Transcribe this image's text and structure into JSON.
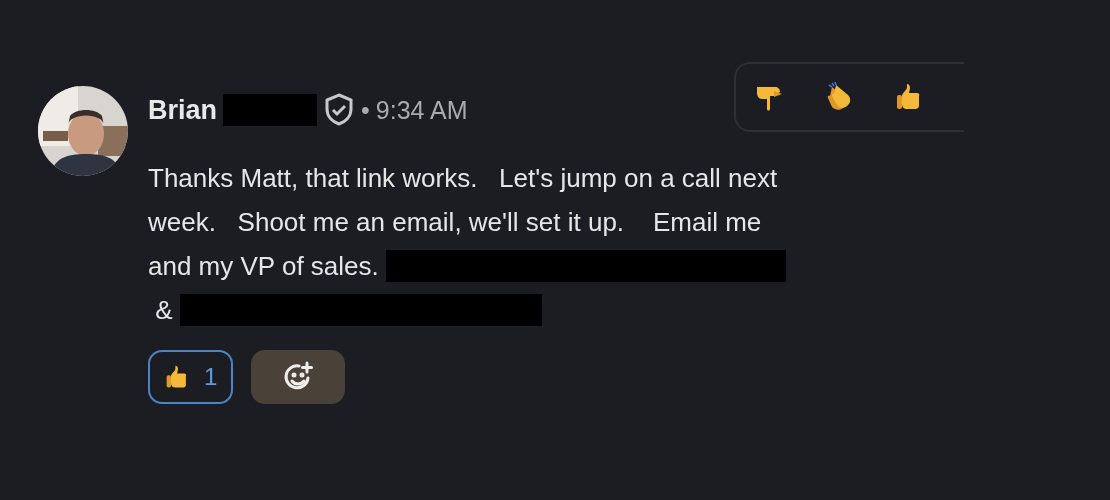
{
  "message": {
    "avatar": {
      "kind": "picture"
    },
    "author": "Brian",
    "author_redacted": true,
    "verified": true,
    "separator": "•",
    "time": "9:34 AM",
    "lines": [
      [
        {
          "kind": "text",
          "text": "Thanks Matt, that link works.   Let's jump on a call next"
        }
      ],
      [
        {
          "kind": "text",
          "text": "week.   Shoot me an email, we'll set it up.    Email me"
        }
      ],
      [
        {
          "kind": "text",
          "text": "and my VP of sales. "
        },
        {
          "kind": "redacted"
        }
      ],
      [
        {
          "kind": "text",
          "text": " & "
        },
        {
          "kind": "redacted"
        }
      ]
    ],
    "reactions": [
      {
        "kind": "thumbs-up",
        "count": "1",
        "selected": true
      }
    ],
    "quick_reactions": [
      {
        "kind": "pointing-down"
      },
      {
        "kind": "clap"
      },
      {
        "kind": "thumbs-up"
      }
    ]
  }
}
